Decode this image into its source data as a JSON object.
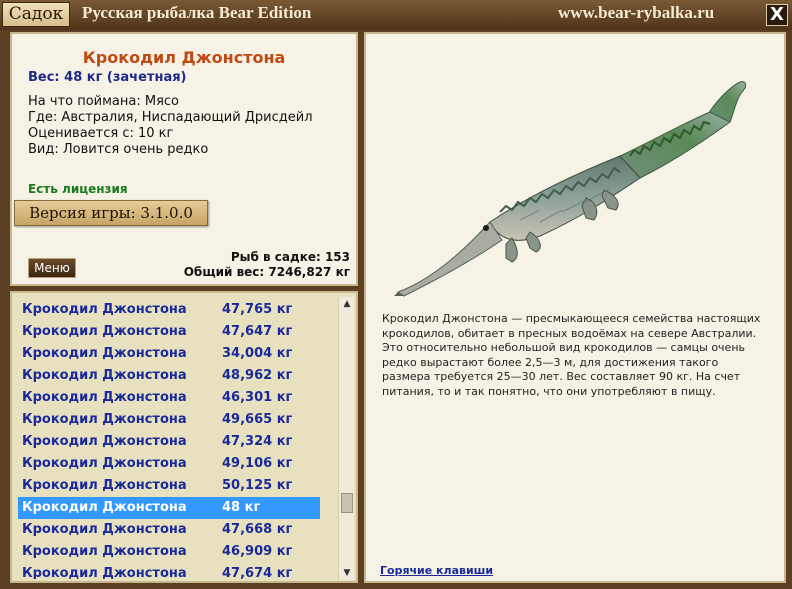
{
  "titlebar": {
    "tab_label": "Садок",
    "app_title": "Русская рыбалка Bear Edition",
    "site_url": "www.bear-rybalka.ru",
    "close_label": "X"
  },
  "info": {
    "fish_name": "Крокодил Джонстона",
    "weight_line": "Вес: 48 кг (зачетная)",
    "rows": [
      "На что поймана: Мясо",
      "Где: Австралия, Ниспадающий Дрисдейл",
      "Оценивается с: 10 кг",
      "Вид: Ловится очень редко"
    ],
    "license": "Есть лицензия",
    "version": "Версия игры: 3.1.0.0",
    "menu_label": "Меню",
    "fish_count": "Рыб в садке: 153",
    "total_weight": "Общий вес: 7246,827 кг"
  },
  "fish_list": [
    {
      "name": "Крокодил Джонстона",
      "weight": "47,765 кг"
    },
    {
      "name": "Крокодил Джонстона",
      "weight": "47,647 кг"
    },
    {
      "name": "Крокодил Джонстона",
      "weight": "34,004 кг"
    },
    {
      "name": "Крокодил Джонстона",
      "weight": "48,962 кг"
    },
    {
      "name": "Крокодил Джонстона",
      "weight": "46,301 кг"
    },
    {
      "name": "Крокодил Джонстона",
      "weight": "49,665 кг"
    },
    {
      "name": "Крокодил Джонстона",
      "weight": "47,324 кг"
    },
    {
      "name": "Крокодил Джонстона",
      "weight": "49,106 кг"
    },
    {
      "name": "Крокодил Джонстона",
      "weight": "50,125 кг"
    },
    {
      "name": "Крокодил Джонстона",
      "weight": "48 кг"
    },
    {
      "name": "Крокодил Джонстона",
      "weight": "47,668 кг"
    },
    {
      "name": "Крокодил Джонстона",
      "weight": "46,909 кг"
    },
    {
      "name": "Крокодил Джонстона",
      "weight": "47,674 кг"
    }
  ],
  "selected_index": 9,
  "detail": {
    "description": "Крокодил Джонстона — пресмыкающееся семейства настоящих крокодилов, обитает в пресных водоёмах на севере Австралии. Это относительно небольшой вид крокодилов — самцы очень редко вырастают более 2,5—3 м, для достижения такого размера требуется 25—30 лет. Вес составляет 90 кг. На счет питания, то и так понятно, что они употребляют в пищу.",
    "hotkeys_label": "Горячие клавиши"
  },
  "colors": {
    "frame_brown": "#5a3f22",
    "panel_bg": "#f6f3e6",
    "fish_name": "#c04a14",
    "list_text": "#1a2a9a",
    "selection": "#3399ff",
    "license_green": "#1a7a1a"
  }
}
